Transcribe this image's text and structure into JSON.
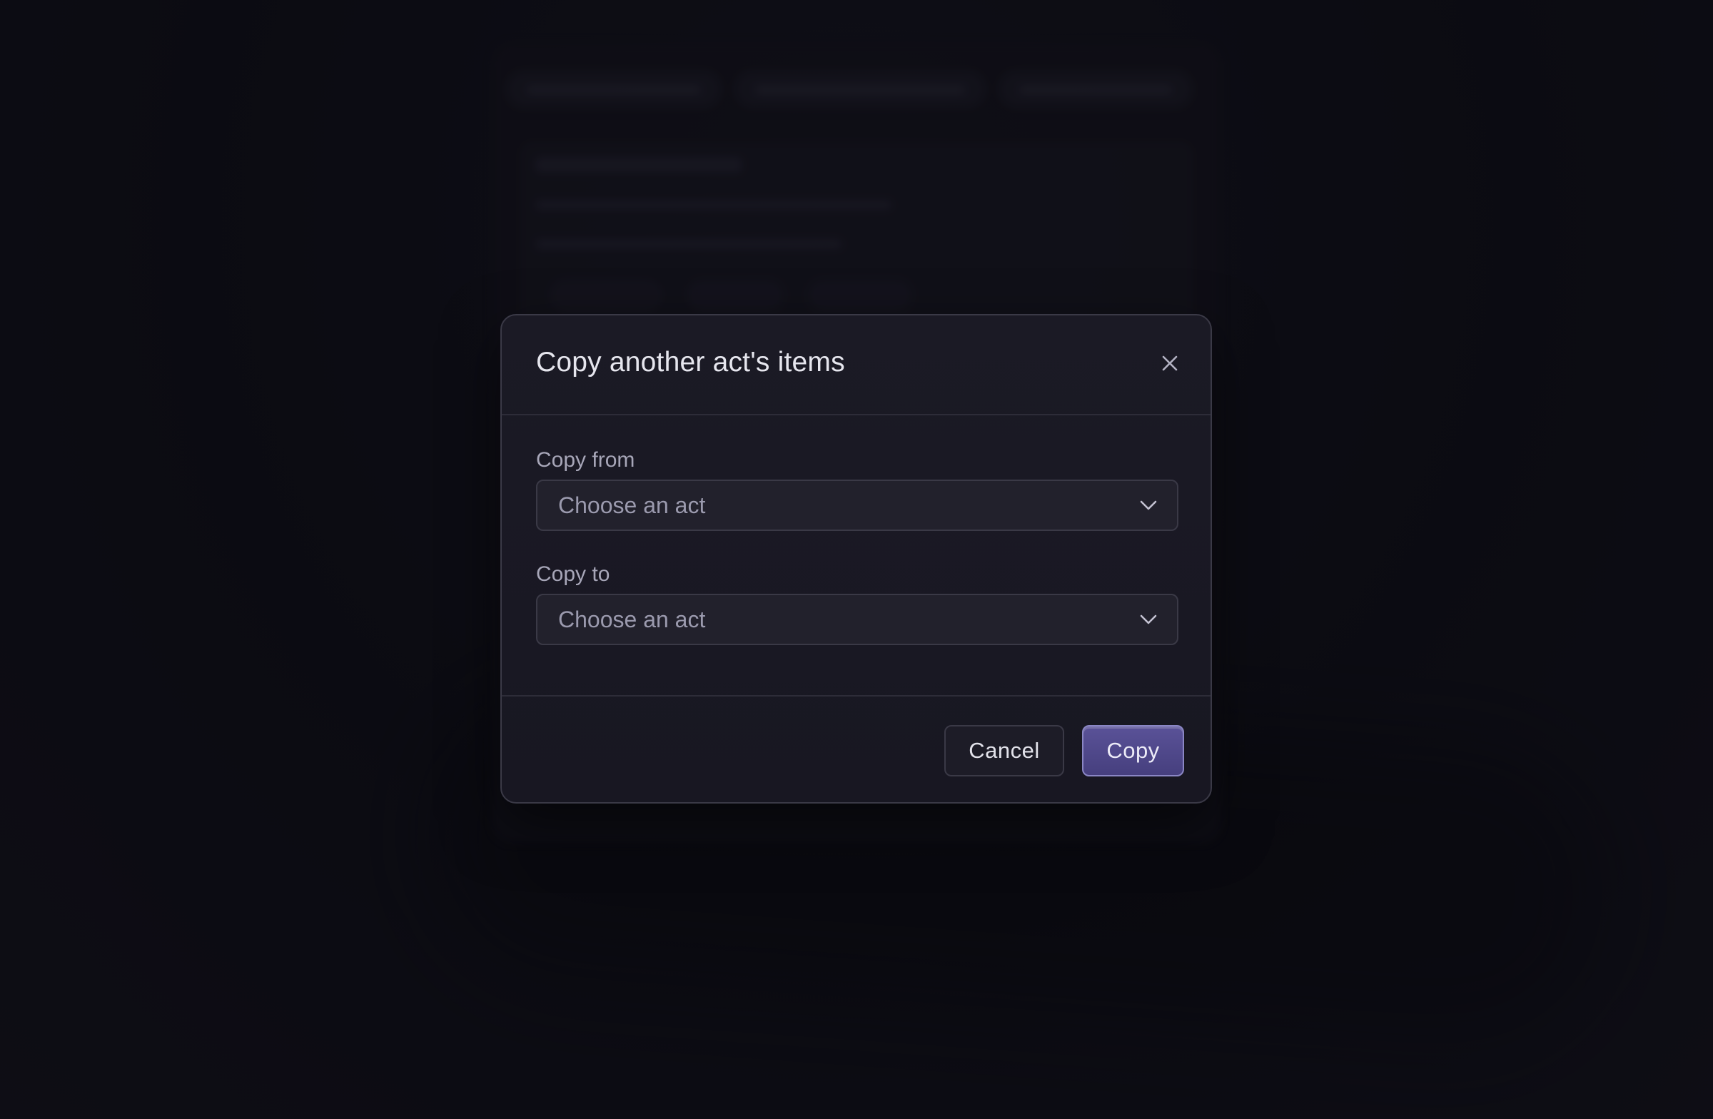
{
  "modal": {
    "title": "Copy another act's items",
    "close_icon": "close-icon",
    "fields": [
      {
        "label": "Copy from",
        "placeholder": "Choose an act"
      },
      {
        "label": "Copy to",
        "placeholder": "Choose an act"
      }
    ],
    "buttons": {
      "cancel_label": "Cancel",
      "copy_label": "Copy"
    }
  },
  "colors": {
    "background": "#0e0e16",
    "modal_bg": "#1b1a25",
    "primary_button": "#4f478a",
    "text_primary": "#e6e6ee",
    "text_muted": "#a7a6b8"
  }
}
